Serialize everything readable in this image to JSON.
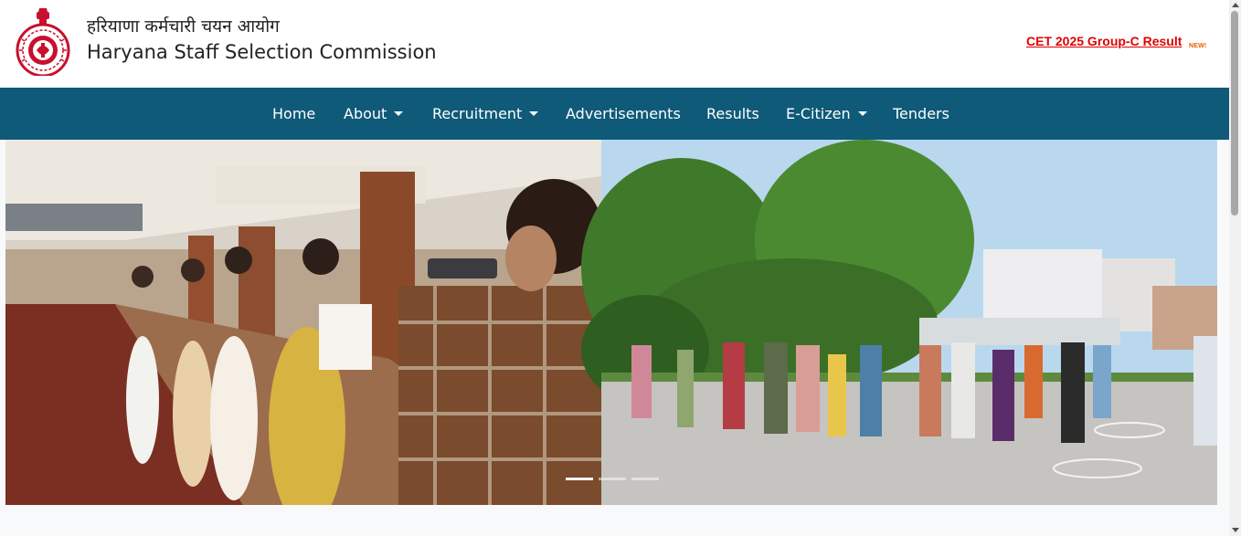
{
  "header": {
    "title_hindi": "हरियाणा कर्मचारी चयन आयोग",
    "title_english": "Haryana Staff Selection Commission",
    "news_link": "CET 2025 Group-C Result",
    "new_badge": "NEW!"
  },
  "nav": {
    "items": [
      {
        "label": "Home",
        "dropdown": false
      },
      {
        "label": "About",
        "dropdown": true
      },
      {
        "label": "Recruitment",
        "dropdown": true
      },
      {
        "label": "Advertisements",
        "dropdown": false
      },
      {
        "label": "Results",
        "dropdown": false
      },
      {
        "label": "E-Citizen",
        "dropdown": true
      },
      {
        "label": "Tenders",
        "dropdown": false
      }
    ]
  },
  "carousel": {
    "slide_count": 3,
    "active_slide": 1,
    "images": [
      "candidates-queue-hall-photo",
      "candidates-queue-outdoor-photo"
    ]
  },
  "colors": {
    "navbar": "#0f5a78",
    "news_link": "#e00000",
    "emblem": "#c8102e"
  },
  "icons": [
    "haryana-emblem-icon",
    "caret-down-icon"
  ]
}
